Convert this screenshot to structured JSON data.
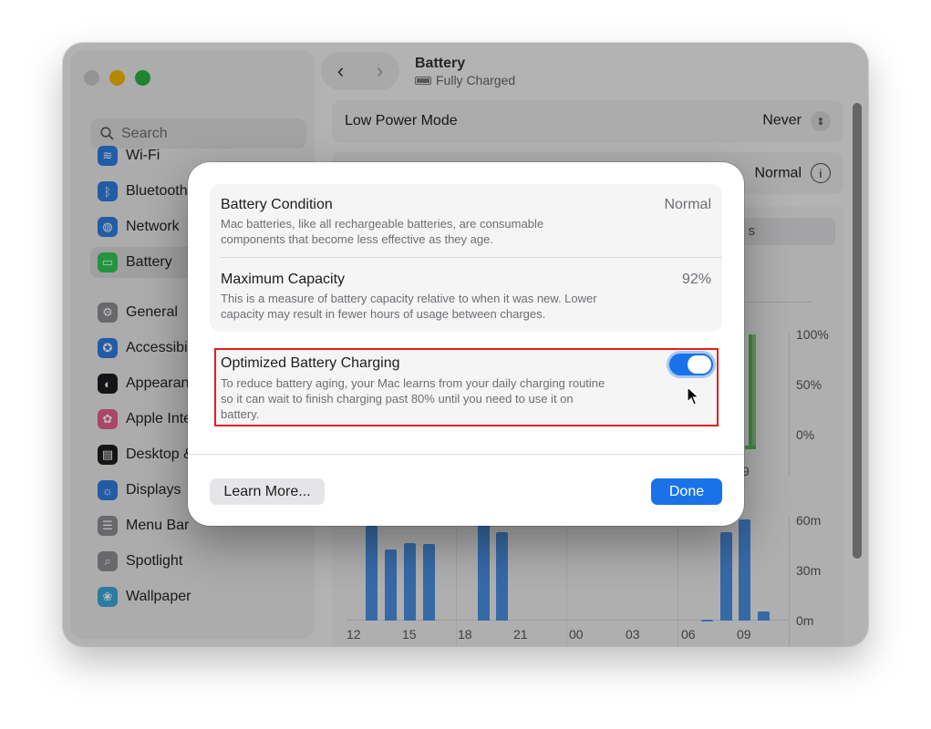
{
  "window": {
    "title": "Battery",
    "subtitle": "Fully Charged"
  },
  "sidebar": {
    "search_placeholder": "Search",
    "items": [
      {
        "label": "Wi-Fi",
        "icon": "wifi-icon",
        "color": "#2f7de1"
      },
      {
        "label": "Bluetooth",
        "icon": "bluetooth-icon",
        "color": "#2f7de1"
      },
      {
        "label": "Network",
        "icon": "globe-icon",
        "color": "#2f7de1"
      },
      {
        "label": "Battery",
        "icon": "battery-icon",
        "color": "#34c759"
      },
      {
        "label": "General",
        "icon": "gear-icon",
        "color": "#8e8e93"
      },
      {
        "label": "Accessibili",
        "icon": "accessibility-icon",
        "color": "#2f7de1"
      },
      {
        "label": "Appearanc",
        "icon": "appearance-icon",
        "color": "#1d1d1f"
      },
      {
        "label": "Apple Intel",
        "icon": "apple-intelligence-icon",
        "color": "#e3608a"
      },
      {
        "label": "Desktop &",
        "icon": "desktop-icon",
        "color": "#1d1d1f"
      },
      {
        "label": "Displays",
        "icon": "displays-icon",
        "color": "#2f7de1"
      },
      {
        "label": "Menu Bar",
        "icon": "menu-bar-icon",
        "color": "#8e8e93"
      },
      {
        "label": "Spotlight",
        "icon": "spotlight-icon",
        "color": "#8e8e93"
      },
      {
        "label": "Wallpaper",
        "icon": "wallpaper-icon",
        "color": "#3aa8d8"
      }
    ]
  },
  "main": {
    "low_power_label": "Low Power Mode",
    "low_power_value": "Never",
    "battery_health_value": "Normal",
    "segment_partial": "s",
    "chart_y_pct": [
      "100%",
      "50%",
      "0%"
    ],
    "chart_x_top": "9",
    "chart_y_time": [
      "60m",
      "30m",
      "0m"
    ],
    "chart_x": [
      "12",
      "15",
      "18",
      "21",
      "00",
      "03",
      "06",
      "09"
    ]
  },
  "dialog": {
    "condition_title": "Battery Condition",
    "condition_value": "Normal",
    "condition_desc_1": "Mac batteries, like all rechargeable batteries, are consumable",
    "condition_desc_2": "components that become less effective as they age.",
    "capacity_title": "Maximum Capacity",
    "capacity_value": "92%",
    "capacity_desc_1": "This is a measure of battery capacity relative to when it was new. Lower",
    "capacity_desc_2": "capacity may result in fewer hours of usage between charges.",
    "optimized_title": "Optimized Battery Charging",
    "optimized_desc_1": "To reduce battery aging, your Mac learns from your daily charging routine",
    "optimized_desc_2": "so it can wait to finish charging past 80% until you need to use it on",
    "optimized_desc_3": "battery.",
    "optimized_enabled": true,
    "learn_more_label": "Learn More...",
    "done_label": "Done"
  },
  "colors": {
    "accent": "#1a72e8",
    "highlight_border": "#e02020"
  }
}
